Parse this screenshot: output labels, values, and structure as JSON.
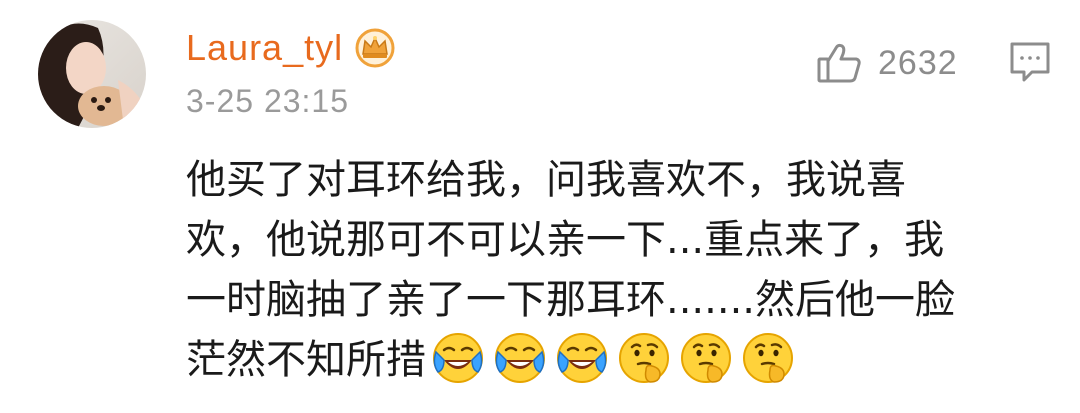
{
  "user": {
    "name": "Laura_tyl",
    "badge_icon": "crown-icon",
    "avatar_icon": "avatar"
  },
  "timestamp": "3-25 23:15",
  "actions": {
    "like_icon": "thumbs-up-icon",
    "like_count": "2632",
    "comment_icon": "comment-icon"
  },
  "comment": {
    "lines": [
      "他买了对耳环给我，问我喜欢不，我说喜",
      "欢，他说那可不可以亲一下...重点来了，我",
      "一时脑抽了亲了一下那耳环.......然后他一脸",
      "茫然不知所措"
    ],
    "emojis": [
      "laughing-crying-emoji",
      "laughing-crying-emoji",
      "laughing-crying-emoji",
      "thinking-emoji",
      "thinking-emoji",
      "thinking-emoji"
    ]
  },
  "colors": {
    "username": "#e86a1e",
    "timestamp": "#9a9a9a",
    "like_count": "#8c8c8c",
    "body_text": "#1a1a1a",
    "crown": "#f0a23a"
  }
}
